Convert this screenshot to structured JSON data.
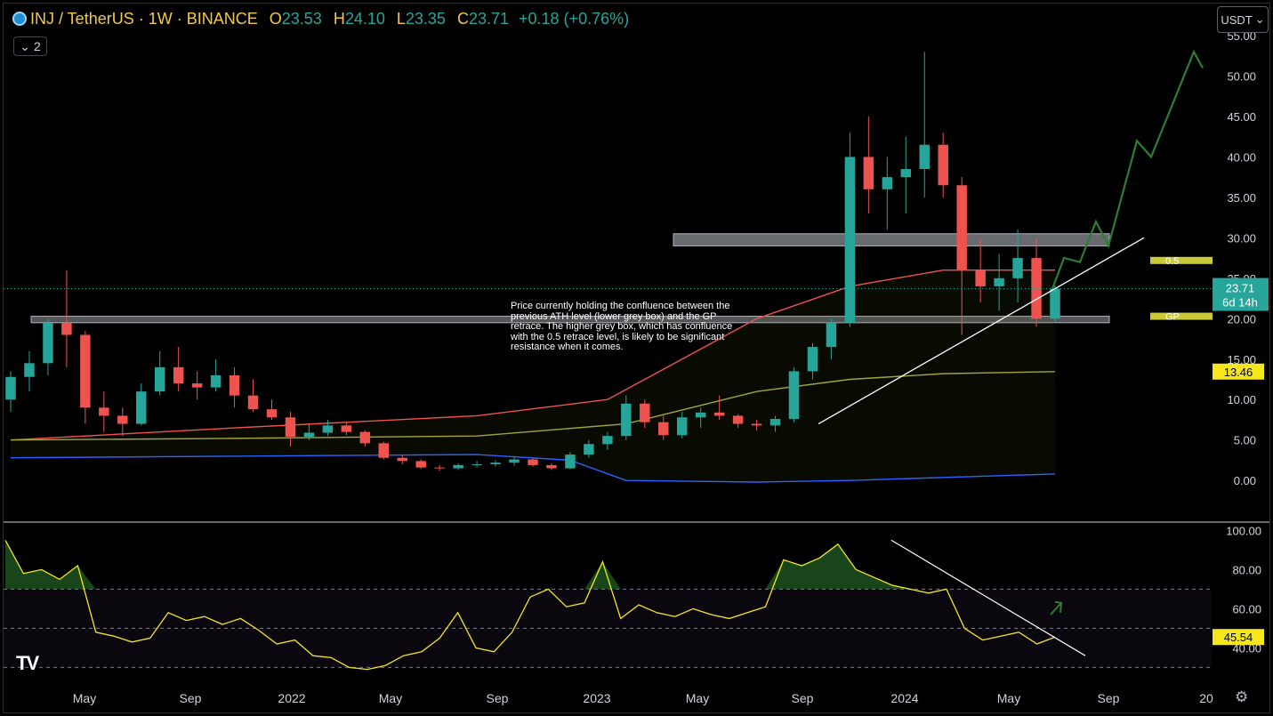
{
  "header": {
    "symbol": "INJ / TetherUS · 1W · BINANCE",
    "o_label": "O",
    "o_value": "23.53",
    "h_label": "H",
    "h_value": "24.10",
    "l_label": "L",
    "l_value": "23.35",
    "c_label": "C",
    "c_value": "23.71",
    "change": "+0.18 (+0.76%)",
    "indicator_count": "2",
    "collapse_icon": "chevron-down-icon"
  },
  "toolbar": {
    "currency": "USDT"
  },
  "annotation": {
    "text": "Price currently holding the confluence between the previous ATH level (lower grey box) and the GP retrace. The higher grey box, which has confluence with the 0.5 retrace level, is likely to be significant resistance when it comes."
  },
  "branding": {
    "logo_text": "TV"
  },
  "colors": {
    "up": "#26a69a",
    "down": "#ef5350",
    "rsi": "#f5e71c",
    "fib": "#c9c93a",
    "box": "#b2b5be"
  },
  "chart_data": [
    {
      "type": "candlestick",
      "title": "INJ / TetherUS · 1W · BINANCE",
      "x_ticks": [
        "May",
        "Sep",
        "2022",
        "May",
        "Sep",
        "2023",
        "May",
        "Sep",
        "2024",
        "May",
        "Sep",
        "20"
      ],
      "y_ticks": [
        "55.00",
        "50.00",
        "45.00",
        "40.00",
        "35.00",
        "30.00",
        "25.00",
        "20.00",
        "15.00",
        "10.00",
        "5.00",
        "0.00"
      ],
      "ylim": [
        -3.5,
        55
      ],
      "last_price": "23.71",
      "countdown": "6d 14h",
      "ma_value": "13.46",
      "candles_sampled_ohlc": [
        [
          10,
          13.5,
          8.5,
          12.8
        ],
        [
          12.8,
          16,
          11,
          14.5
        ],
        [
          14.5,
          20,
          13,
          19.5
        ],
        [
          19.5,
          26,
          14,
          18
        ],
        [
          18,
          18.5,
          7,
          9
        ],
        [
          9,
          11,
          6,
          8
        ],
        [
          8,
          9,
          5.5,
          7
        ],
        [
          7,
          12,
          6.8,
          11
        ],
        [
          11,
          16,
          10.5,
          14
        ],
        [
          14,
          16.5,
          11,
          12
        ],
        [
          12,
          13.5,
          10,
          11.5
        ],
        [
          11.5,
          15,
          11,
          13
        ],
        [
          13,
          14,
          9,
          10.5
        ],
        [
          10.5,
          12.5,
          8.5,
          8.8
        ],
        [
          8.8,
          10,
          7.5,
          7.8
        ],
        [
          7.8,
          8.5,
          4.2,
          5.4
        ],
        [
          5.4,
          7,
          5,
          5.9
        ],
        [
          5.9,
          7.5,
          5.5,
          6.8
        ],
        [
          6.8,
          7.2,
          5.6,
          6.0
        ],
        [
          6,
          6.2,
          4.2,
          4.6
        ],
        [
          4.6,
          4.8,
          2.6,
          2.8
        ],
        [
          2.8,
          3.2,
          2.0,
          2.4
        ],
        [
          2.4,
          2.6,
          1.4,
          1.6
        ],
        [
          1.6,
          1.9,
          1.2,
          1.5
        ],
        [
          1.5,
          2.1,
          1.3,
          1.9
        ],
        [
          1.9,
          2.4,
          1.6,
          2.0
        ],
        [
          2.0,
          2.5,
          1.7,
          2.2
        ],
        [
          2.2,
          3.0,
          1.8,
          2.6
        ],
        [
          2.6,
          2.8,
          1.7,
          1.9
        ],
        [
          1.9,
          2.1,
          1.3,
          1.5
        ],
        [
          1.5,
          3.5,
          1.4,
          3.2
        ],
        [
          3.2,
          5.0,
          2.8,
          4.5
        ],
        [
          4.5,
          6,
          3.8,
          5.5
        ],
        [
          5.5,
          10.5,
          5.0,
          9.5
        ],
        [
          9.5,
          10.0,
          6.5,
          7.2
        ],
        [
          7.2,
          8.0,
          5.0,
          5.6
        ],
        [
          5.6,
          8.5,
          5.2,
          7.8
        ],
        [
          7.8,
          9.0,
          6.5,
          8.4
        ],
        [
          8.4,
          10.5,
          7.5,
          8.0
        ],
        [
          8.0,
          8.2,
          6.5,
          7.0
        ],
        [
          7.0,
          7.5,
          6.2,
          6.8
        ],
        [
          6.8,
          8.0,
          6.0,
          7.6
        ],
        [
          7.6,
          14.0,
          7.2,
          13.5
        ],
        [
          13.5,
          17.0,
          12.5,
          16.5
        ],
        [
          16.5,
          20.0,
          15.0,
          19.5
        ],
        [
          19.5,
          43.0,
          19.0,
          40.0
        ],
        [
          40.0,
          45.0,
          33.0,
          36.0
        ],
        [
          36.0,
          40.0,
          31.0,
          37.5
        ],
        [
          37.5,
          42.5,
          33.0,
          38.5
        ],
        [
          38.5,
          53.0,
          35.0,
          41.5
        ],
        [
          41.5,
          43.0,
          35.0,
          36.5
        ],
        [
          36.5,
          37.5,
          18.0,
          26.0
        ],
        [
          26.0,
          30.0,
          22.0,
          24.0
        ],
        [
          24.0,
          28.0,
          21.0,
          25.0
        ],
        [
          25.0,
          31.0,
          22.0,
          27.5
        ],
        [
          27.5,
          30.0,
          19.0,
          20.0
        ],
        [
          20.0,
          24.1,
          19.5,
          23.71
        ]
      ],
      "series": [
        {
          "name": "",
          "color": "#ef5350",
          "points": [
            [
              0,
              5
            ],
            [
              12,
              6.5
            ],
            [
              25,
              8
            ],
            [
              32,
              10
            ],
            [
              40,
              20
            ],
            [
              45,
              24
            ],
            [
              50,
              26
            ],
            [
              56,
              26
            ]
          ]
        },
        {
          "name": "",
          "color": "#a3a338",
          "points": [
            [
              0,
              5
            ],
            [
              12,
              5.2
            ],
            [
              25,
              5.5
            ],
            [
              33,
              7
            ],
            [
              40,
              11
            ],
            [
              45,
              12.5
            ],
            [
              50,
              13.2
            ],
            [
              56,
              13.46
            ]
          ]
        },
        {
          "name": "",
          "color": "#2962ff",
          "points": [
            [
              0,
              2.8
            ],
            [
              12,
              3
            ],
            [
              25,
              3.2
            ],
            [
              30,
              2.5
            ],
            [
              33,
              0
            ],
            [
              40,
              -0.2
            ],
            [
              45,
              0
            ],
            [
              56,
              0.8
            ]
          ]
        }
      ],
      "fib_labels": [
        "0.5",
        "GP"
      ],
      "fib_values": [
        27.2,
        20.3
      ]
    },
    {
      "type": "line",
      "title": "",
      "y_ticks": [
        "100.00",
        "80.00",
        "60.00",
        "40.00"
      ],
      "ylim": [
        27,
        102
      ],
      "bands": [
        70,
        50,
        30
      ],
      "last_value": "45.54",
      "values": [
        95,
        78,
        80,
        75,
        82,
        48,
        46,
        43,
        45,
        58,
        54,
        56,
        52,
        55,
        49,
        42,
        44,
        36,
        35,
        30,
        29,
        31,
        36,
        38,
        45,
        58,
        40,
        38,
        48,
        66,
        70,
        61,
        63,
        84,
        55,
        62,
        58,
        56,
        60,
        57,
        55,
        58,
        61,
        85,
        82,
        86,
        93,
        80,
        76,
        72,
        70,
        68,
        70,
        50,
        44,
        46,
        48,
        42,
        45.54
      ]
    }
  ]
}
